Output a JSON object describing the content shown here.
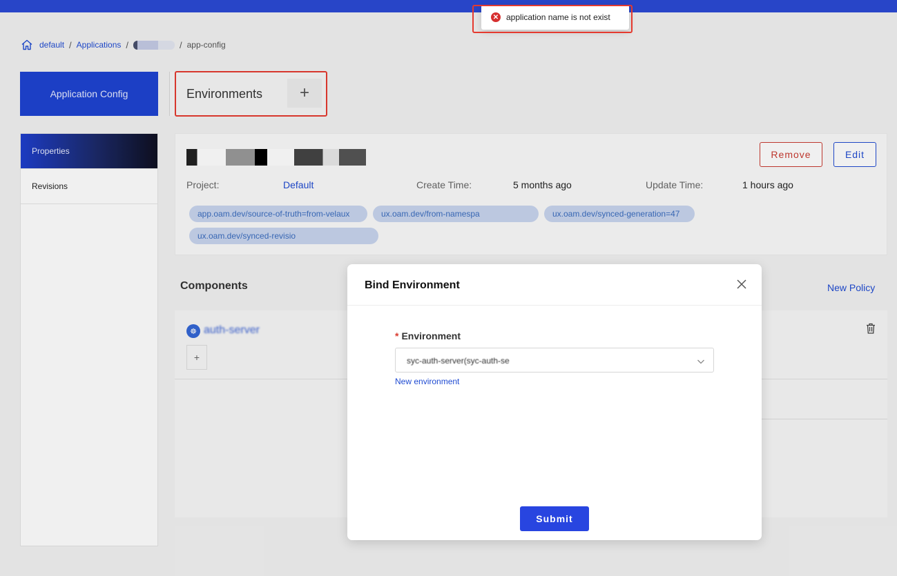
{
  "breadcrumb": {
    "items": [
      "default",
      "Applications"
    ],
    "current": "app-config"
  },
  "sidebar": {
    "header": "Application Config",
    "items": [
      {
        "label": "Properties"
      },
      {
        "label": "Revisions"
      }
    ]
  },
  "environments": {
    "tab_label": "Environments",
    "add_symbol": "+"
  },
  "app_info": {
    "remove_label": "Remove",
    "edit_label": "Edit",
    "project_label": "Project:",
    "project_value": "Default",
    "create_label": "Create Time:",
    "create_value": "5 months ago",
    "update_label": "Update Time:",
    "update_value": "1 hours ago",
    "tags": [
      "app.oam.dev/source-of-truth=from-velaux",
      "ux.oam.dev/from-namespa",
      "ux.oam.dev/synced-generation=47",
      "ux.oam.dev/synced-revisio"
    ]
  },
  "components": {
    "title": "Components",
    "new_policy": "New Policy",
    "item_name": "auth-server",
    "add_symbol": "+"
  },
  "modal": {
    "title": "Bind Environment",
    "field_required": "*",
    "field_label": "Environment",
    "select_value": "syc-auth-server(syc-auth-se",
    "new_env_link": "New environment",
    "submit_label": "Submit"
  },
  "toast": {
    "message": "application name is not exist"
  },
  "colors": {
    "accent": "#1e43d2",
    "danger": "#c93a30",
    "highlight": "#e53a2f"
  }
}
